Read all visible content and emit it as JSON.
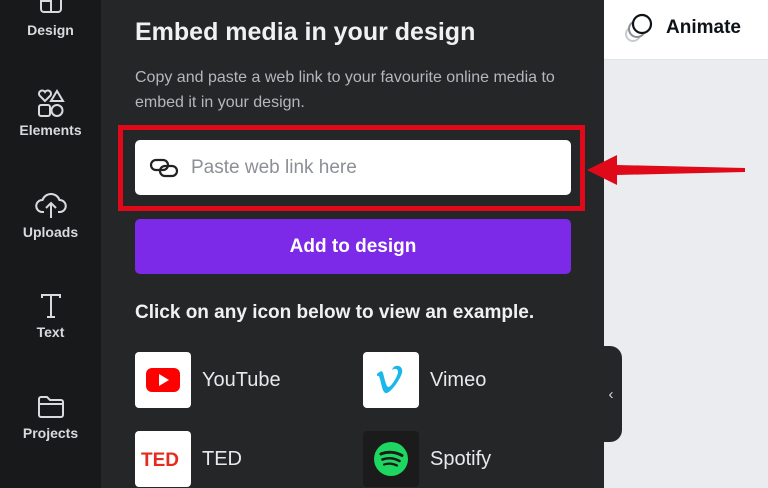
{
  "sidebar": {
    "items": [
      {
        "label": "Design",
        "icon": "design-icon"
      },
      {
        "label": "Elements",
        "icon": "elements-icon"
      },
      {
        "label": "Uploads",
        "icon": "upload-cloud-icon"
      },
      {
        "label": "Text",
        "icon": "text-icon"
      },
      {
        "label": "Projects",
        "icon": "folder-icon"
      }
    ]
  },
  "panel": {
    "title": "Embed media in your design",
    "description": "Copy and paste a web link to your favourite online media to embed it in your design.",
    "input": {
      "placeholder": "Paste web link here",
      "value": ""
    },
    "add_button": "Add to design",
    "example_heading": "Click on any icon below to view an example.",
    "services": [
      {
        "name": "YouTube",
        "icon": "youtube-icon",
        "color": "#ff0000"
      },
      {
        "name": "Vimeo",
        "icon": "vimeo-icon",
        "color": "#1ab7ea"
      },
      {
        "name": "TED",
        "icon": "ted-icon",
        "color": "#e62b1e"
      },
      {
        "name": "Spotify",
        "icon": "spotify-icon",
        "color": "#1ed760"
      }
    ]
  },
  "topbar": {
    "animate_label": "Animate"
  },
  "colors": {
    "sidebar_bg": "#18191b",
    "panel_bg": "#252627",
    "accent_purple": "#7d2ae8",
    "highlight_red": "#e0091a"
  }
}
